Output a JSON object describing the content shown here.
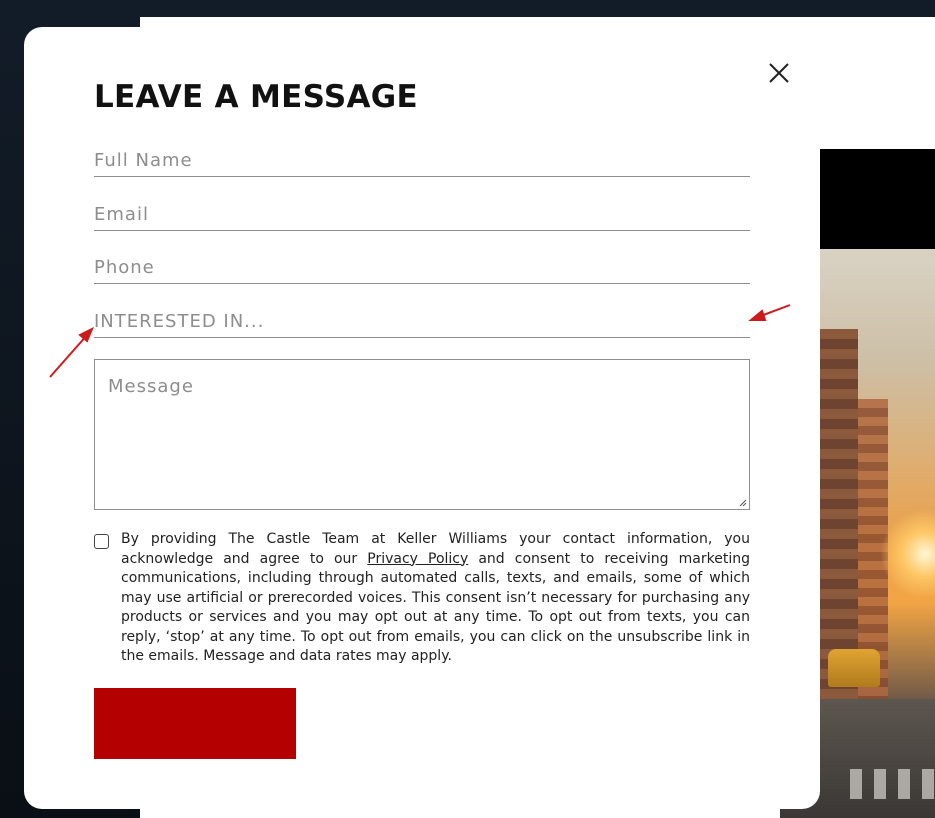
{
  "modal": {
    "title": "LEAVE A MESSAGE",
    "close_icon": "close-icon"
  },
  "form": {
    "full_name_placeholder": "Full Name",
    "email_placeholder": "Email",
    "phone_placeholder": "Phone",
    "interested_in_placeholder": "INTERESTED IN...",
    "message_placeholder": "Message",
    "consent": {
      "text_before_link": "By providing The Castle Team at Keller Williams your contact information, you acknowledge and agree to our ",
      "link_text": "Privacy Policy",
      "text_after_link": " and consent to receiving marketing communications, including through automated calls, texts, and emails, some of which may use artificial or prerecorded voices. This consent isn’t necessary for purchasing any products or services and you may opt out at any time. To opt out from texts, you can reply, ‘stop’ at any time. To opt out from emails, you can click on the unsubscribe link in the emails. Message and data rates may apply.",
      "checked": false
    },
    "submit_label": "",
    "submit_color": "#b50000"
  },
  "annotations": {
    "arrow_color": "#cc1b1b"
  }
}
